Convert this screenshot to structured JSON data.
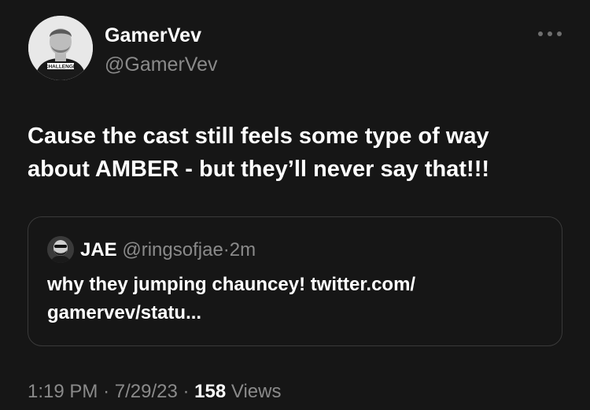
{
  "author": {
    "name": "GamerVev",
    "handle": "@GamerVev",
    "shirt_text": "CHALLENGE"
  },
  "tweet": {
    "text_line1": "Cause the cast still feels some type of way",
    "text_line2": "about AMBER - but they’ll never say that!!!"
  },
  "quote": {
    "name": "JAE",
    "handle": "@ringsofjae",
    "separator": "·",
    "time": "2m",
    "text_line1": "why they jumping chauncey! twitter.com/",
    "text_line2": "gamervev/statu..."
  },
  "footer": {
    "time": "1:19 PM",
    "sep1": "·",
    "date": "7/29/23",
    "sep2": "·",
    "views_count": "158",
    "views_label": "Views"
  },
  "icons": {
    "more": "more-horizontal-icon"
  },
  "colors": {
    "background": "#161616",
    "primary_text": "#ffffff",
    "secondary_text": "#8a8a8a",
    "border": "#3a3a3a"
  }
}
